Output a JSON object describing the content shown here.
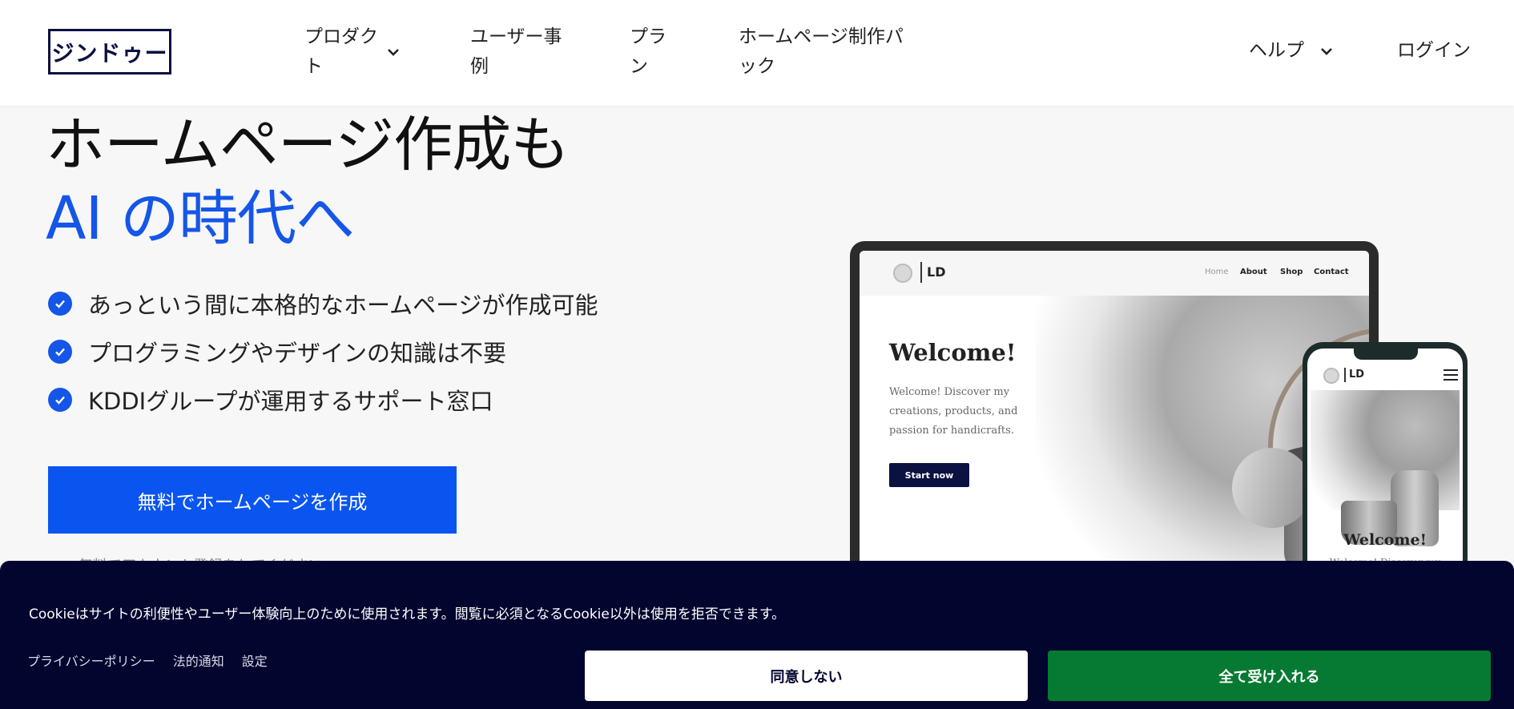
{
  "header": {
    "logo_text": "ジンドゥー",
    "nav": {
      "products": "プロダクト",
      "cases": "ユーザー事例",
      "plan": "プラン",
      "pack": "ホームページ制作パック",
      "help": "ヘルプ",
      "login": "ログイン"
    }
  },
  "hero": {
    "title_line1": "ホームページ作成も",
    "title_line2": "AI の時代へ",
    "features": [
      "あっという間に本格的なホームページが作成可能",
      "プログラミングやデザインの知識は不要",
      "KDDIグループが運用するサポート窓口"
    ],
    "cta_label": "無料でホームページを作成",
    "cta_note": "無料でアカウント登録をしてください"
  },
  "preview": {
    "logo_text": "LD",
    "menu": [
      "Home",
      "About",
      "Shop",
      "Contact"
    ],
    "welcome": "Welcome!",
    "description": "Welcome! Discover my creations, products, and passion for handicrafts.",
    "button_label": "Start now",
    "mobile_welcome": "Welcome!",
    "mobile_desc": "Welcome! Discover my"
  },
  "cookie_banner": {
    "text": "Cookieはサイトの利便性やユーザー体験向上のために使用されます。閲覧に必須となるCookie以外は使用を拒否できます。",
    "links": [
      "プライバシーポリシー",
      "法的通知",
      "設定"
    ],
    "decline_label": "同意しない",
    "accept_label": "全て受け入れる"
  },
  "colors": {
    "brand_navy": "#0b1140",
    "accent_blue": "#1556e8",
    "cta_blue": "#0a55f0",
    "cookie_bg": "#02052e",
    "accept_green": "#067a32"
  },
  "icons": {
    "chevron": "chevron-down-icon",
    "check": "check-circle-icon",
    "menu": "hamburger-menu-icon"
  }
}
